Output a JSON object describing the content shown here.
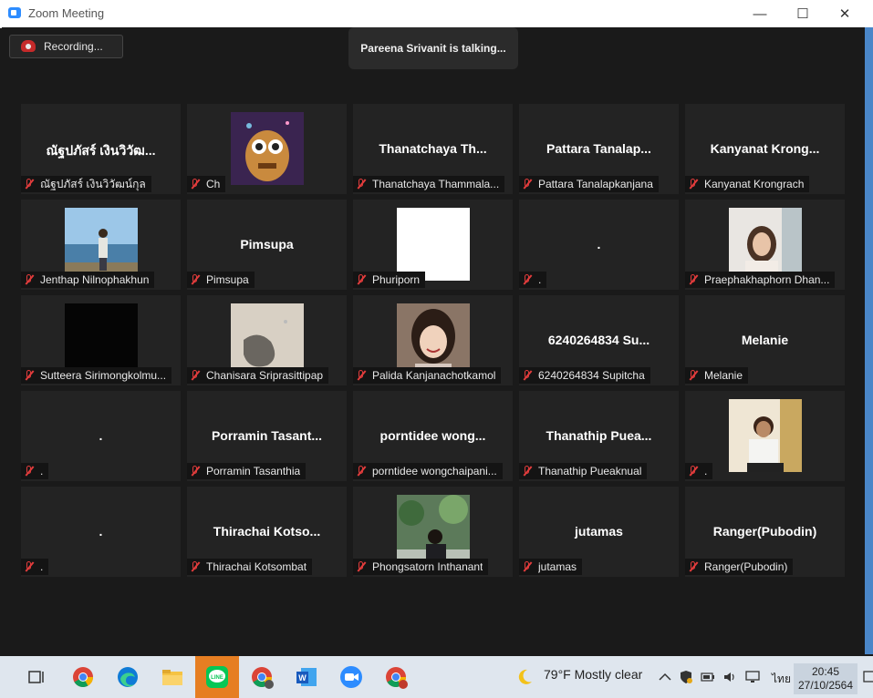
{
  "window": {
    "title": "Zoom Meeting",
    "minimize": "—",
    "maximize": "☐",
    "close": "✕"
  },
  "recording": {
    "label": "Recording..."
  },
  "talking": {
    "text": "Pareena Srivanit is talking..."
  },
  "tiles": [
    {
      "center": "ณัฐปภัสร์ เงินวิวัฒ...",
      "label": "ณัฐปภัสร์ เงินวิวัฒน์กุล"
    },
    {
      "center": "",
      "label": "Ch",
      "image": "animated-character-photo"
    },
    {
      "center": "Thanatchaya Th...",
      "label": "Thanatchaya Thammala..."
    },
    {
      "center": "Pattara Tanalap...",
      "label": "Pattara Tanalapkanjana"
    },
    {
      "center": "Kanyanat Krong...",
      "label": "Kanyanat Krongrach"
    },
    {
      "center": "",
      "label": "Jenthap Nilnophakhun",
      "image": "beach-photo"
    },
    {
      "center": "Pimsupa",
      "label": "Pimsupa"
    },
    {
      "center": "",
      "label": "Phuriporn",
      "image": "white-photo"
    },
    {
      "center": ".",
      "label": "."
    },
    {
      "center": "",
      "label": "Praephakhaphorn Dhan...",
      "image": "portrait-photo"
    },
    {
      "center": "",
      "label": "Sutteera Sirimongkolmu...",
      "image": "black-photo"
    },
    {
      "center": "",
      "label": "Chanisara Sriprasittipap",
      "image": "sand-photo"
    },
    {
      "center": "",
      "label": "Palida Kanjanachotkamol",
      "image": "selfie-photo"
    },
    {
      "center": "6240264834 Su...",
      "label": "6240264834 Supitcha"
    },
    {
      "center": "Melanie",
      "label": "Melanie"
    },
    {
      "center": ".",
      "label": "."
    },
    {
      "center": "Porramin Tasant...",
      "label": "Porramin Tasanthia"
    },
    {
      "center": "porntidee wong...",
      "label": "porntidee wongchaipani..."
    },
    {
      "center": "Thanathip Puea...",
      "label": "Thanathip Pueaknual"
    },
    {
      "center": "",
      "label": ".",
      "image": "portrait-photo-2"
    },
    {
      "center": ".",
      "label": "."
    },
    {
      "center": "Thirachai Kotso...",
      "label": "Thirachai Kotsombat"
    },
    {
      "center": "",
      "label": "Phongsatorn Inthanant",
      "image": "garden-photo"
    },
    {
      "center": "jutamas",
      "label": "jutamas"
    },
    {
      "center": "Ranger(Pubodin)",
      "label": "Ranger(Pubodin)"
    }
  ],
  "taskbar": {
    "weather": "79°F  Mostly clear",
    "lang": "ไทย",
    "time": "20:45",
    "date": "27/10/2564",
    "icons": [
      "task-view-icon",
      "chrome-icon",
      "edge-icon",
      "file-explorer-icon",
      "line-icon",
      "chrome-profile-a-icon",
      "word-icon",
      "zoom-icon",
      "chrome-profile-l-icon"
    ]
  },
  "colors": {
    "mute": "#e23c3c",
    "tile": "#232323",
    "accent": "#2d8cff"
  }
}
